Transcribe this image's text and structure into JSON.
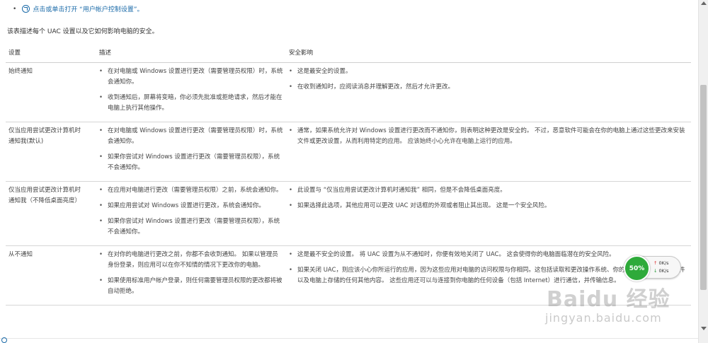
{
  "top_link": {
    "bullet": "•",
    "text": "点击或单击打开 “用户帐户控制设置”。"
  },
  "intro": "该表描述每个 UAC 设置以及它如何影响电脑的安全。",
  "table": {
    "headers": [
      "设置",
      "描述",
      "安全影响"
    ],
    "rows": [
      {
        "setting": "始终通知",
        "desc": [
          "在对电脑或 Windows 设置进行更改（需要管理员权限）时，系统会通知你。",
          "收到通知后，屏幕将变暗，你必须先批准或拒绝请求，然后才能在电脑上执行其他操作。"
        ],
        "impact": [
          "这是最安全的设置。",
          "在收到通知时，应阅读消息并理解更改，然后才允许更改。"
        ]
      },
      {
        "setting": "仅当应用尝试更改计算机时通知我(默认)",
        "desc": [
          "在对电脑或 Windows 设置进行更改（需要管理员权限）时，系统会通知你。",
          "如果你尝试对 Windows 设置进行更改（需要管理员权限），系统不会通知你。"
        ],
        "impact": [
          "通常，如果系统允许对 Windows 设置进行更改而不通知你，则表明这种更改是安全的。 不过，恶意软件可能会在你的电脑上通过这些更改来安装文件或更改设置，从而利用特定的应用。 应该始终小心允许在电脑上运行的应用。"
        ]
      },
      {
        "setting": "仅当应用尝试更改计算机时通知我（不降低桌面亮度）",
        "desc": [
          "在应用对电脑进行更改（需要管理员权限）之前，系统会通知你。",
          "如果应用尝试对 Windows 设置进行更改，系统会通知你。",
          "如果你尝试对 Windows 设置进行更改（需要管理员权限），系统不会通知你。"
        ],
        "impact": [
          "此设置与 “仅当应用尝试更改计算机时通知我” 相同，但是不会降低桌面亮度。",
          "如果选择此选项，其他应用可以更改 UAC 对话框的外观或者阻止其出现。 这是一个安全风险。"
        ]
      },
      {
        "setting": "从不通知",
        "desc": [
          "在对你的电脑进行更改之前，你都不会收到通知。 如果以管理员身份登录，则应用可以在你不知情的情况下更改你的电脑。",
          "如果使用标准用户帐户登录，则任何需要管理员权限的更改都将被自动拒绝。"
        ],
        "impact": [
          "这是最不安全的设置。 将 UAC 设置为从不通知时，你便有效地关闭了 UAC。 这会使得你的电脑面临潜在的安全风险。",
          "如果关闭 UAC，则应该小心你所运行的应用，因为这些应用对电脑的访问权限与你相同。这包括读取和更改操作系统、你的个人数据、保存的文件以及电脑上存储的任何其他内容。 这些应用还可以与连接到你电脑的任何设备（包括 Internet）进行通信，并传输信息。"
        ]
      }
    ]
  },
  "net_meter": {
    "percent": "50%",
    "up": "0K/s",
    "down": "0K/s",
    "up_arrow": "↑",
    "down_arrow": "↓"
  },
  "watermark": {
    "main": "Baidu 经验",
    "sub": "jingyan.baidu.com"
  }
}
